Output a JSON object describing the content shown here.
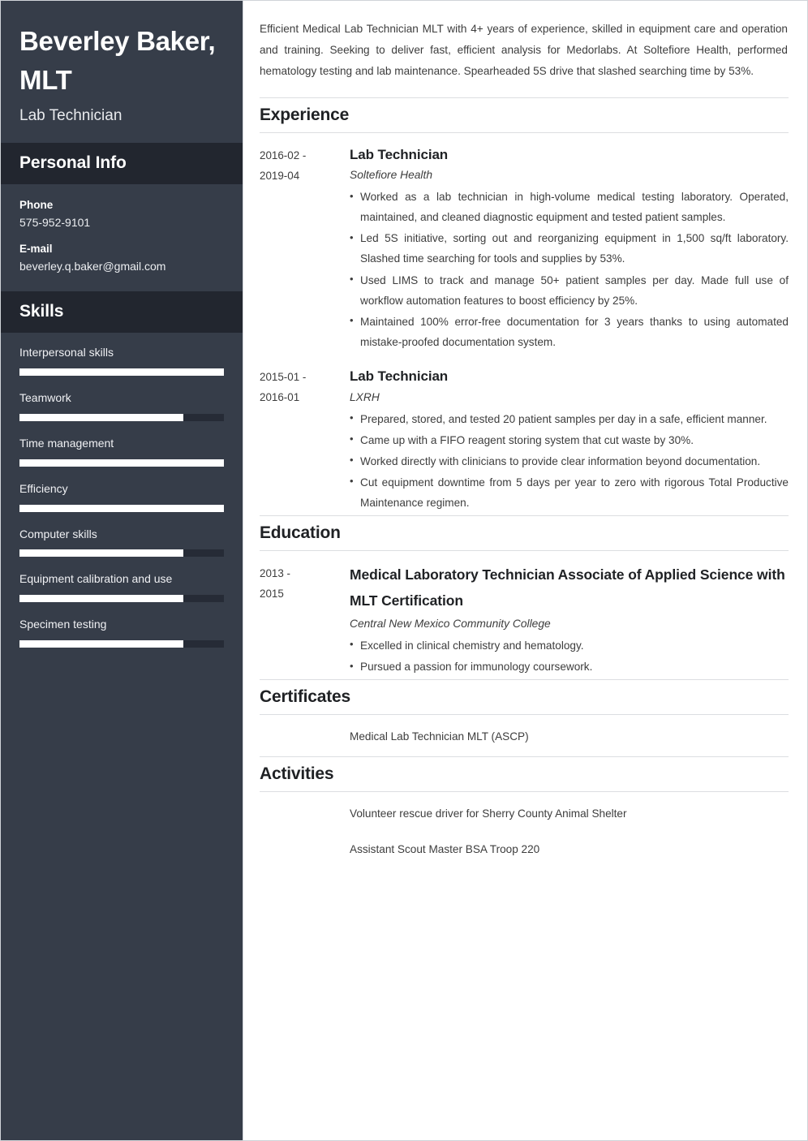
{
  "sidebar": {
    "full_name": "Beverley Baker, MLT",
    "job_title": "Lab Technician",
    "personal_info": {
      "heading": "Personal Info",
      "items": [
        {
          "label": "Phone",
          "value": "575-952-9101"
        },
        {
          "label": "E-mail",
          "value": "beverley.q.baker@gmail.com"
        }
      ]
    },
    "skills": {
      "heading": "Skills",
      "items": [
        {
          "name": "Interpersonal skills",
          "level": 100
        },
        {
          "name": "Teamwork",
          "level": 80
        },
        {
          "name": "Time management",
          "level": 100
        },
        {
          "name": "Efficiency",
          "level": 100
        },
        {
          "name": "Computer skills",
          "level": 80
        },
        {
          "name": "Equipment calibration and use",
          "level": 80
        },
        {
          "name": "Specimen testing",
          "level": 80
        }
      ]
    },
    "colors": {
      "background": "#363d49",
      "section_header_background": "#22262f",
      "skill_track": "#262b36",
      "skill_fill": "#ffffff"
    }
  },
  "main": {
    "summary": "Efficient Medical Lab Technician MLT with 4+ years of experience, skilled in equipment care and operation and training. Seeking to deliver fast, efficient analysis for Medorlabs. At Soltefiore Health, performed hematology testing and lab maintenance. Spearheaded 5S drive that slashed searching time by 53%.",
    "experience": {
      "heading": "Experience",
      "entries": [
        {
          "dates": "2016-02 - 2019-04",
          "date_line_1": "2016-02 -",
          "date_line_2": "2019-04",
          "title": "Lab Technician",
          "organization": "Soltefiore Health",
          "bullets": [
            "Worked as a lab technician in high-volume medical testing laboratory. Operated, maintained, and cleaned diagnostic equipment and tested patient samples.",
            "Led 5S initiative, sorting out and reorganizing equipment in 1,500 sq/ft laboratory. Slashed time searching for tools and supplies by 53%.",
            "Used LIMS to track and manage 50+ patient samples per day. Made full use of workflow automation features to boost efficiency by 25%.",
            "Maintained 100% error-free documentation for 3 years thanks to using automated mistake-proofed documentation system."
          ]
        },
        {
          "dates": "2015-01 - 2016-01",
          "date_line_1": "2015-01 -",
          "date_line_2": "2016-01",
          "title": "Lab Technician",
          "organization": "LXRH",
          "bullets": [
            "Prepared, stored, and tested 20 patient samples per day in a safe, efficient manner.",
            "Came up with a FIFO reagent storing system that cut waste by 30%.",
            "Worked directly with clinicians to provide clear information beyond documentation.",
            "Cut equipment downtime from 5 days per year to zero with rigorous Total Productive Maintenance regimen."
          ]
        }
      ]
    },
    "education": {
      "heading": "Education",
      "entries": [
        {
          "dates": "2013 - 2015",
          "date_line_1": "2013 -",
          "date_line_2": "2015",
          "title": "Medical Laboratory Technician Associate of Applied Science with MLT Certification",
          "organization": "Central New Mexico Community College",
          "bullets": [
            "Excelled in clinical chemistry and hematology.",
            "Pursued a passion for immunology coursework."
          ]
        }
      ]
    },
    "certificates": {
      "heading": "Certificates",
      "items": [
        "Medical Lab Technician MLT (ASCP)"
      ]
    },
    "activities": {
      "heading": "Activities",
      "items": [
        "Volunteer rescue driver for Sherry County Animal Shelter",
        "Assistant Scout Master BSA Troop 220"
      ]
    }
  }
}
